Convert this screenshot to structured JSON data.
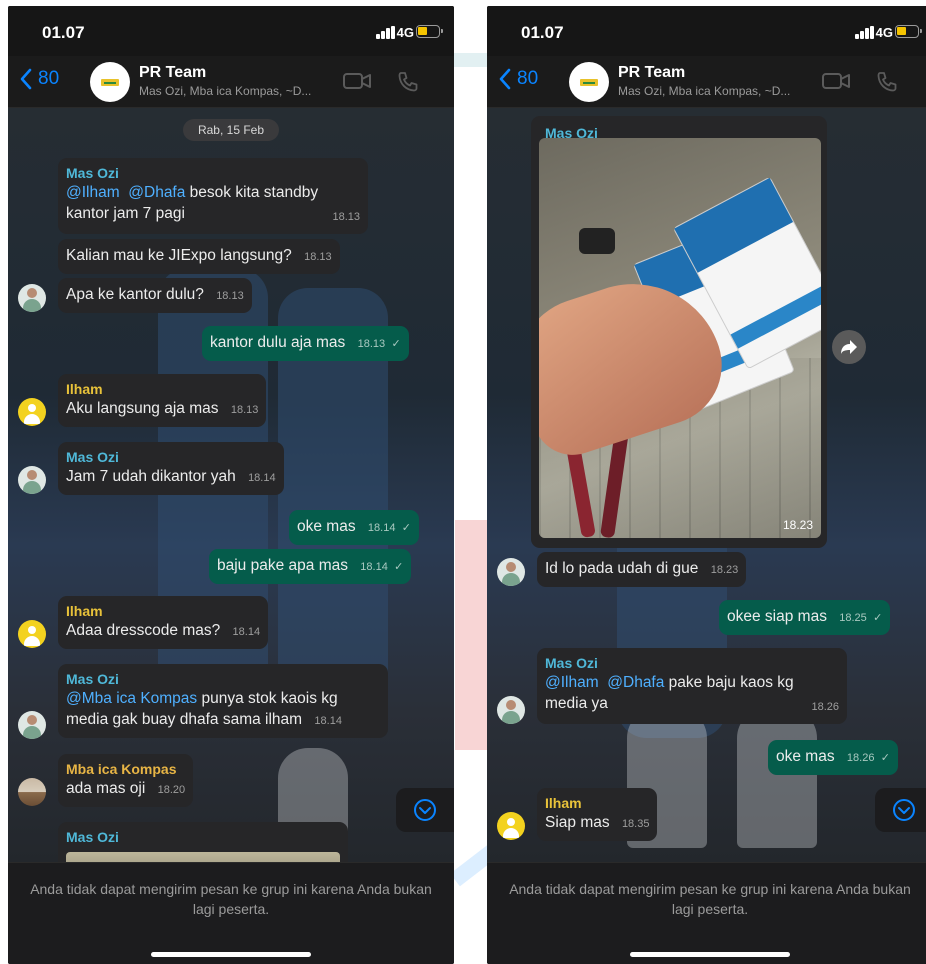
{
  "left": {
    "status": {
      "time": "01.07",
      "network": "4G"
    },
    "header": {
      "back_count": "80",
      "title": "PR Team",
      "subtitle": "Mas Ozi, Mba ica Kompas, ~D..."
    },
    "date_pill": "Rab, 15 Feb",
    "messages": [
      {
        "sender": "Mas Ozi",
        "m1": "@Ilham",
        "m2": "@Dhafa",
        "text": " besok kita standby kantor jam 7 pagi",
        "time": "18.13"
      },
      {
        "text": "Kalian mau ke JIExpo langsung?",
        "time": "18.13"
      },
      {
        "text": "Apa ke kantor dulu?",
        "time": "18.13"
      },
      {
        "text": "kantor dulu aja mas",
        "time": "18.13"
      },
      {
        "sender": "Ilham",
        "text": "Aku langsung aja mas",
        "time": "18.13"
      },
      {
        "sender": "Mas Ozi",
        "text": "Jam 7 udah dikantor yah",
        "time": "18.14"
      },
      {
        "text": "oke mas",
        "time": "18.14"
      },
      {
        "text": "baju pake apa mas",
        "time": "18.14"
      },
      {
        "sender": "Ilham",
        "text": "Adaa dresscode mas?",
        "time": "18.14"
      },
      {
        "sender": "Mas Ozi",
        "m1": "@Mba ica Kompas",
        "text": " punya stok kaois kg media gak buay dhafa sama ilham",
        "time": "18.14"
      },
      {
        "sender": "Mba ica Kompas",
        "text": "ada mas oji",
        "time": "18.20"
      },
      {
        "sender": "Mas Ozi"
      }
    ],
    "composer_note": "Anda tidak dapat mengirim pesan ke grup ini karena Anda bukan lagi peserta."
  },
  "right": {
    "status": {
      "time": "01.07",
      "network": "4G"
    },
    "header": {
      "back_count": "80",
      "title": "PR Team",
      "subtitle": "Mas Ozi, Mba ica Kompas, ~D..."
    },
    "photo_message": {
      "sender": "Mas Ozi",
      "time": "18.23"
    },
    "messages": [
      {
        "text": "Id lo pada udah di gue",
        "time": "18.23"
      },
      {
        "text": "okee siap mas",
        "time": "18.25"
      },
      {
        "sender": "Mas Ozi",
        "m1": "@Ilham",
        "m2": "@Dhafa",
        "text": " pake baju kaos kg media ya",
        "time": "18.26"
      },
      {
        "text": "oke mas",
        "time": "18.26"
      },
      {
        "sender": "Ilham",
        "text": "Siap mas",
        "time": "18.35"
      }
    ],
    "composer_note": "Anda tidak dapat mengirim pesan ke grup ini karena Anda bukan lagi peserta."
  },
  "colors": {
    "accent": "#0a84ff",
    "outgoing_bubble": "#055c4b",
    "incoming_bubble": "#262628",
    "sender_ozi": "#4fb8d8",
    "sender_ilham": "#e8c23a",
    "mention": "#4fb0ff"
  },
  "icons": [
    "back-chevron-icon",
    "video-call-icon",
    "phone-call-icon",
    "scroll-down-icon",
    "forward-icon",
    "read-check-icon"
  ]
}
